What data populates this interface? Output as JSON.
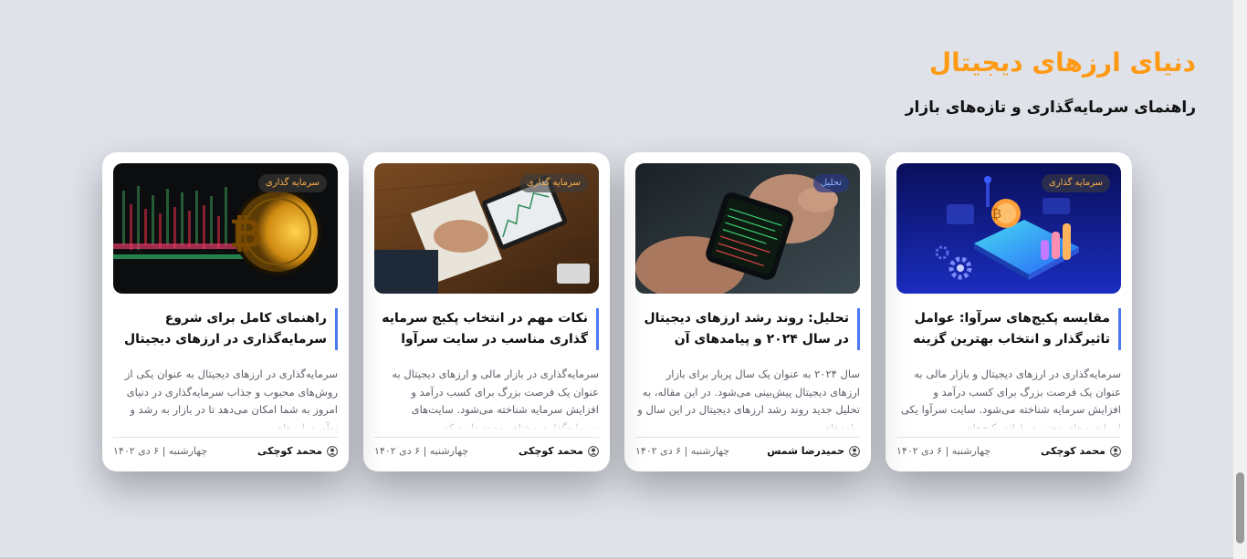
{
  "section": {
    "title": "دنیای ارزهای دیجیتال",
    "subtitle": "راهنمای سرمایه‌گذاری و تازه‌های بازار"
  },
  "colors": {
    "accent": "#ff9a14",
    "title_bar": "#4d79f0",
    "background": "#dfe2e9"
  },
  "cards": [
    {
      "badge": "سرمایه گذاری",
      "image_icon": "crypto-platform-illustration",
      "title": "مقایسه پکیج‌های سرآوا: عوامل تاثیرگذار و انتخاب بهترین گزینه",
      "excerpt": "سرمایه‌گذاری در ارزهای دیجیتال و بازار مالی به عنوان یک فرصت بزرگ برای کسب درآمد و افزایش سرمایه شناخته می‌شود. سایت سرآوا یکی از پلتفرم‌های معتبر در ارائه پکیج‌های",
      "author": "محمد کوچکی",
      "date": "چهارشنبه | ۶ دی ۱۴۰۲"
    },
    {
      "badge": "تحلیل",
      "image_icon": "phone-trading-photo",
      "title": "تحلیل: روند رشد ارزهای دیجیتال در سال ۲۰۲۴ و پیامدهای آن",
      "excerpt": "سال ۲۰۲۴ به عنوان یک سال پربار برای بازار ارزهای دیجیتال پیش‌بینی می‌شود. در این مقاله، به تحلیل جدید روند رشد ارزهای دیجیتال در این سال و پیامدهای",
      "author": "حمیدرضا شمس",
      "date": "چهارشنبه | ۶ دی ۱۴۰۲"
    },
    {
      "badge": "سرمایه گذاری",
      "image_icon": "tablet-chart-photo",
      "title": "نکات مهم در انتخاب پکیج سرمایه گذاری مناسب در سایت سرآوا",
      "excerpt": "سرمایه‌گذاری در بازار مالی و ارزهای دیجیتال به عنوان یک فرصت بزرگ برای کسب درآمد و افزایش سرمایه شناخته می‌شود. سایت‌های سرمایه‌گذاری مختلف وجود دارند که",
      "author": "محمد کوچکی",
      "date": "چهارشنبه | ۶ دی ۱۴۰۲"
    },
    {
      "badge": "سرمایه گذاری",
      "image_icon": "bitcoin-coin-photo",
      "title": "راهنمای کامل برای شروع سرمایه‌گذاری در ارزهای دیجیتال",
      "excerpt": "سرمایه‌گذاری در ارزهای دیجیتال به عنوان یکی از روش‌های محبوب و جذاب سرمایه‌گذاری در دنیای امروز به شما امکان می‌دهد تا در بازار به رشد و نوآوری ارزهای",
      "author": "محمد کوچکی",
      "date": "چهارشنبه | ۶ دی ۱۴۰۲"
    }
  ]
}
